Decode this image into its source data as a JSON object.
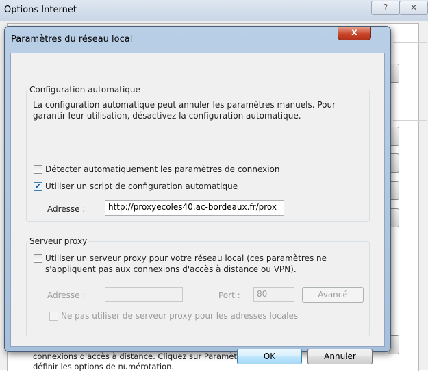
{
  "background_window": {
    "title": "Options Internet",
    "help_glyph": "?",
    "close_glyph": "✕",
    "footer_text_line1": "connexions d'accès à distance. Cliquez sur Paramètres pour",
    "footer_text_line2": "définir les options de numérotation."
  },
  "dialog": {
    "title": "Paramètres du réseau local",
    "close_glyph": "x",
    "auto_config": {
      "legend": "Configuration automatique",
      "description": "La configuration automatique peut annuler les paramètres manuels. Pour garantir leur utilisation, désactivez la configuration automatique.",
      "detect_label": "Détecter automatiquement les paramètres de connexion",
      "detect_checked": false,
      "script_label": "Utiliser un script de configuration automatique",
      "script_checked": true,
      "address_label": "Adresse :",
      "address_value": "http://proxyecoles40.ac-bordeaux.fr/prox"
    },
    "proxy": {
      "legend": "Serveur proxy",
      "use_proxy_label": "Utiliser un serveur proxy pour votre réseau local (ces paramètres ne s'appliquent pas aux connexions d'accès à distance ou VPN).",
      "use_proxy_checked": false,
      "address_label": "Adresse :",
      "address_value": "",
      "port_label": "Port :",
      "port_value": "80",
      "advanced_label": "Avancé",
      "bypass_label": "Ne pas utiliser de serveur proxy pour les adresses locales",
      "bypass_checked": false
    },
    "ok_label": "OK",
    "cancel_label": "Annuler"
  }
}
